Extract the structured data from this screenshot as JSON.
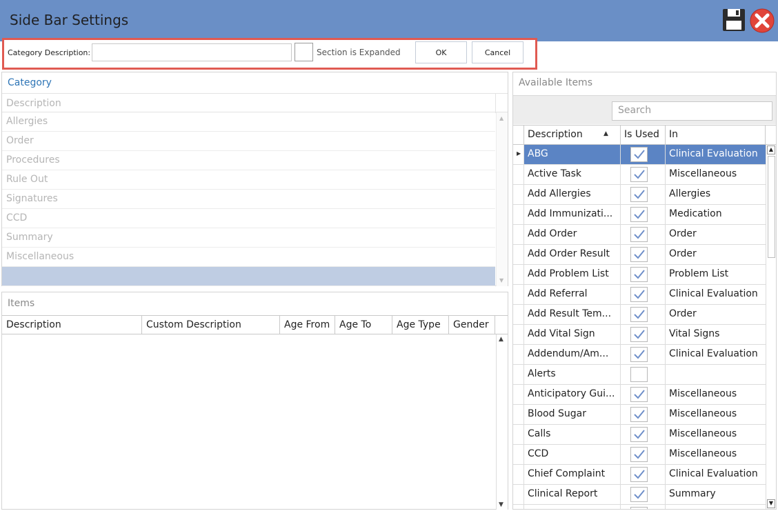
{
  "window": {
    "title": "Side Bar Settings",
    "save_icon": "floppy-disk-icon",
    "close_icon": "red-x-close-icon"
  },
  "edit_row": {
    "category_label": "Category Description:",
    "category_value": "",
    "section_expanded_label": "Section is Expanded",
    "section_expanded_checked": false,
    "ok_label": "OK",
    "cancel_label": "Cancel",
    "highlight_color": "#e05a52"
  },
  "category": {
    "title": "Category",
    "column": "Description",
    "rows": [
      "Allergies",
      "Order",
      "Procedures",
      "Rule Out",
      "Signatures",
      "CCD",
      "Summary",
      "Miscellaneous",
      ""
    ],
    "selected_index": 8
  },
  "items": {
    "title": "Items",
    "columns": [
      "Description",
      "Custom Description",
      "Age From",
      "Age To",
      "Age Type",
      "Gender"
    ]
  },
  "available": {
    "title": "Available Items",
    "search_placeholder": "Search",
    "columns": [
      "Description",
      "Is Used",
      "In"
    ],
    "selected_color": "#5b84c4",
    "rows": [
      {
        "desc": "ABG",
        "used": true,
        "in": "Clinical Evaluation"
      },
      {
        "desc": "Active Task",
        "used": true,
        "in": "Miscellaneous"
      },
      {
        "desc": "Add Allergies",
        "used": true,
        "in": "Allergies"
      },
      {
        "desc": "Add Immunizati...",
        "used": true,
        "in": "Medication"
      },
      {
        "desc": "Add Order",
        "used": true,
        "in": "Order"
      },
      {
        "desc": "Add Order Result",
        "used": true,
        "in": "Order"
      },
      {
        "desc": "Add Problem List",
        "used": true,
        "in": "Problem List"
      },
      {
        "desc": "Add Referral",
        "used": true,
        "in": "Clinical Evaluation"
      },
      {
        "desc": "Add Result Tem...",
        "used": true,
        "in": "Order"
      },
      {
        "desc": "Add Vital Sign",
        "used": true,
        "in": "Vital Signs"
      },
      {
        "desc": "Addendum/Am...",
        "used": true,
        "in": "Clinical Evaluation"
      },
      {
        "desc": "Alerts",
        "used": false,
        "in": ""
      },
      {
        "desc": "Anticipatory Gui...",
        "used": true,
        "in": "Miscellaneous"
      },
      {
        "desc": "Blood Sugar",
        "used": true,
        "in": "Miscellaneous"
      },
      {
        "desc": "Calls",
        "used": true,
        "in": "Miscellaneous"
      },
      {
        "desc": "CCD",
        "used": true,
        "in": "Miscellaneous"
      },
      {
        "desc": "Chief Complaint",
        "used": true,
        "in": "Clinical Evaluation"
      },
      {
        "desc": "Clinical Report",
        "used": true,
        "in": "Summary"
      },
      {
        "desc": "",
        "used": true,
        "in": ""
      }
    ]
  }
}
